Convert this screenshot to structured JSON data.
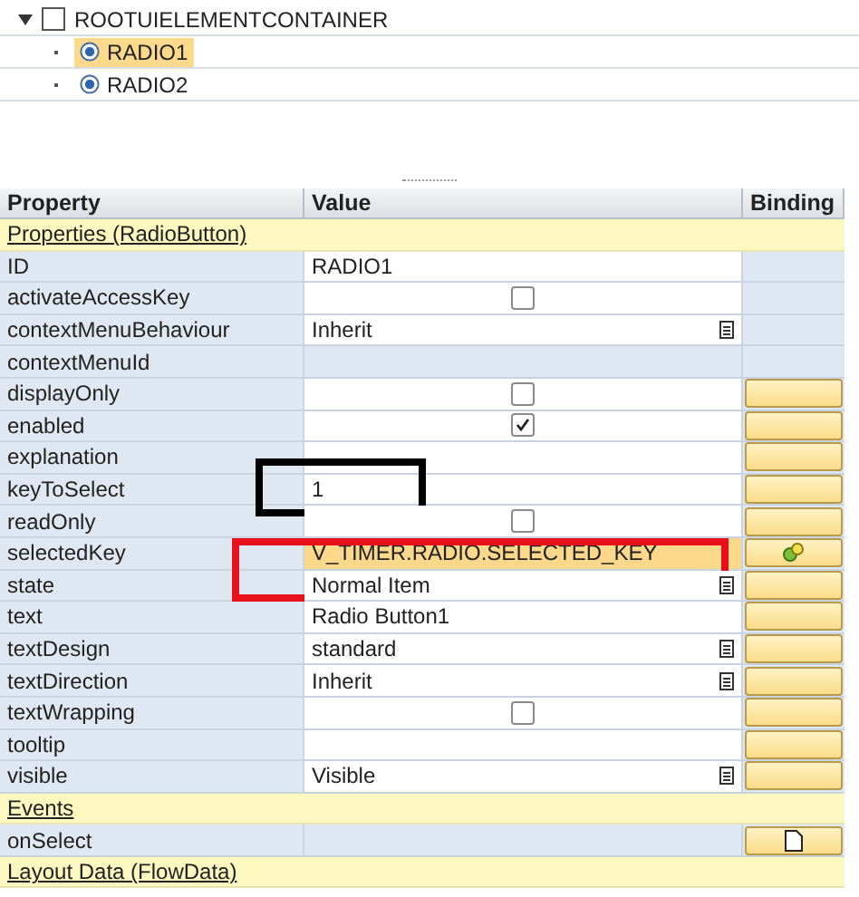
{
  "tree": {
    "label": "ROOTUIELEMENTCONTAINER",
    "expanded": true,
    "children": [
      {
        "label": "RADIO1",
        "selected": true
      },
      {
        "label": "RADIO2",
        "selected": false
      }
    ]
  },
  "table": {
    "columns": [
      "Property",
      "Value",
      "Binding"
    ],
    "rows": [
      {
        "kind": "section",
        "label": "Properties (RadioButton)"
      },
      {
        "kind": "text",
        "name": "ID",
        "value": "RADIO1"
      },
      {
        "kind": "checkbox",
        "name": "activateAccessKey",
        "checked": false
      },
      {
        "kind": "dropdown",
        "name": "contextMenuBehaviour",
        "value": "Inherit"
      },
      {
        "kind": "empty",
        "name": "contextMenuId"
      },
      {
        "kind": "checkbox",
        "name": "displayOnly",
        "checked": false,
        "binding": {
          "kind": "button"
        }
      },
      {
        "kind": "checkbox",
        "name": "enabled",
        "checked": true,
        "binding": {
          "kind": "button"
        }
      },
      {
        "kind": "text",
        "name": "explanation",
        "binding": {
          "kind": "button"
        }
      },
      {
        "kind": "text",
        "name": "keyToSelect",
        "value": "1",
        "binding": {
          "kind": "button"
        },
        "highlight": {
          "color": "#000000"
        }
      },
      {
        "kind": "checkbox",
        "name": "readOnly",
        "checked": false,
        "binding": {
          "kind": "button"
        }
      },
      {
        "kind": "bound",
        "name": "selectedKey",
        "value": "V_TIMER.RADIO.SELECTED_KEY",
        "binding": {
          "kind": "bound"
        },
        "highlight": {
          "color": "#e8101a"
        }
      },
      {
        "kind": "dropdown",
        "name": "state",
        "value": "Normal Item",
        "binding": {
          "kind": "button"
        }
      },
      {
        "kind": "text",
        "name": "text",
        "value": "Radio Button1",
        "binding": {
          "kind": "button"
        }
      },
      {
        "kind": "dropdown",
        "name": "textDesign",
        "value": "standard",
        "binding": {
          "kind": "button"
        }
      },
      {
        "kind": "dropdown",
        "name": "textDirection",
        "value": "Inherit",
        "binding": {
          "kind": "button"
        }
      },
      {
        "kind": "checkbox",
        "name": "textWrapping",
        "checked": false,
        "binding": {
          "kind": "button"
        }
      },
      {
        "kind": "text",
        "name": "tooltip",
        "binding": {
          "kind": "button"
        }
      },
      {
        "kind": "dropdown",
        "name": "visible",
        "value": "Visible",
        "binding": {
          "kind": "button"
        }
      },
      {
        "kind": "section",
        "label": "Events"
      },
      {
        "kind": "empty",
        "name": "onSelect",
        "binding": {
          "kind": "event"
        }
      },
      {
        "kind": "section",
        "label": "Layout Data (FlowData)"
      }
    ]
  }
}
